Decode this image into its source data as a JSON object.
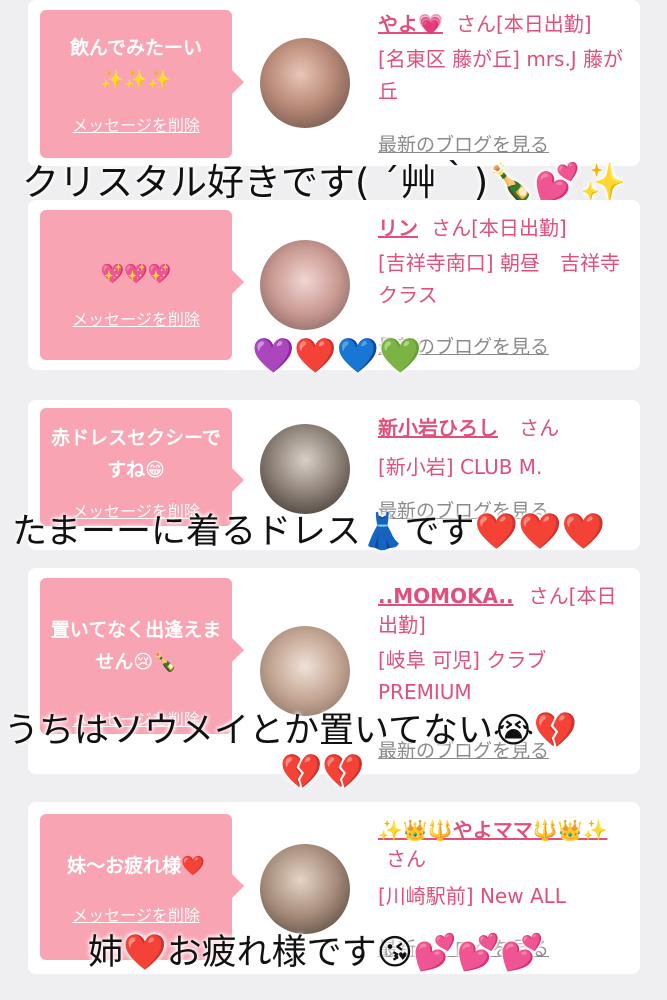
{
  "cards": [
    {
      "message": "飲んでみたーい",
      "message2": "✨✨✨",
      "delete": "メッセージを削除",
      "name": "やよ💗",
      "san": "さん[本日出勤]",
      "area": "[名東区 藤が丘] mrs.J 藤が丘",
      "blog": "最新のブログを見る",
      "overlay": "クリスタル好きです( ´艸｀)🍾💕✨"
    },
    {
      "message": "💖💖💖",
      "delete": "メッセージを削除",
      "name": "リン",
      "san": "さん[本日出勤]",
      "area": "[吉祥寺南口] 朝昼　吉祥寺クラス",
      "blog": "最新のブログを見る",
      "overlay": "💜❤️💙💚"
    },
    {
      "message": "赤ドレスセクシーですね😁",
      "delete": "メッセージを削除",
      "name": "新小岩ひろし",
      "san": "さん",
      "area": "[新小岩] CLUB M.",
      "blog": "最新のブログを見る",
      "overlay": "たまーーに着るドレス👗です❤️❤️❤️"
    },
    {
      "message": "置いてなく出逢えません😢🍾",
      "delete": "メッセージを削除",
      "name": "..MOMOKA..",
      "san": "さん[本日出勤]",
      "area": "[岐阜 可児] クラブ PREMIUM",
      "blog": "最新のブログを見る",
      "overlay": "うちはソウメイとか置いてない😭💔",
      "overlay2": "💔💔"
    },
    {
      "message": "妹〜お疲れ様❤️",
      "delete": "メッセージを削除",
      "name": "✨👑🔱やよママ🔱👑✨",
      "san": "さん",
      "area": "[川崎駅前] New ALL",
      "blog": "最新のブログを見る",
      "overlay": "姉❤️お疲れ様です😘💕💕💕"
    }
  ]
}
